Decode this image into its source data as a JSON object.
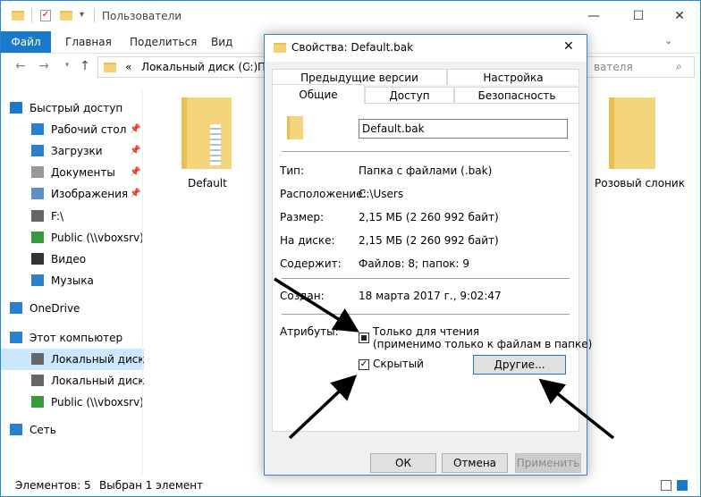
{
  "explorer": {
    "title": "Пользователи",
    "ribbon_tabs": [
      "Файл",
      "Главная",
      "Поделиться",
      "Вид"
    ],
    "address": [
      "«",
      "Локальный диск (C:)",
      "П"
    ],
    "search_placeholder": "вателя",
    "nav": [
      {
        "label": "Быстрый доступ",
        "icon": "star-icon"
      },
      {
        "label": "Рабочий стол",
        "icon": "desktop-icon",
        "pin": true
      },
      {
        "label": "Загрузки",
        "icon": "downloads-icon",
        "pin": true
      },
      {
        "label": "Документы",
        "icon": "documents-icon",
        "pin": true
      },
      {
        "label": "Изображения",
        "icon": "pictures-icon",
        "pin": true
      },
      {
        "label": "F:\\",
        "icon": "drive-icon"
      },
      {
        "label": "Public (\\\\vboxsrv) (I",
        "icon": "network-drive-icon"
      },
      {
        "label": "Видео",
        "icon": "video-icon"
      },
      {
        "label": "Музыка",
        "icon": "music-icon"
      },
      {
        "label": "OneDrive",
        "icon": "cloud-icon"
      },
      {
        "label": "Этот компьютер",
        "icon": "computer-icon"
      },
      {
        "label": "Локальный диск (С",
        "icon": "drive-icon"
      },
      {
        "label": "Локальный диск (D",
        "icon": "drive-icon"
      },
      {
        "label": "Public (\\\\vboxsrv) (I",
        "icon": "network-drive-icon"
      },
      {
        "label": "Сеть",
        "icon": "network-icon"
      }
    ],
    "folders": [
      "Default",
      "Розовый слоник"
    ],
    "status": {
      "count": "Элементов: 5",
      "selected": "Выбран 1 элемент"
    }
  },
  "dialog": {
    "title": "Свойства: Default.bak",
    "tabs_back": [
      "Предыдущие версии",
      "Настройка"
    ],
    "tabs_front": [
      "Общие",
      "Доступ",
      "Безопасность"
    ],
    "name": "Default.bak",
    "rows1": [
      {
        "label": "Тип:",
        "value": "Папка с файлами (.bak)"
      },
      {
        "label": "Расположение:",
        "value": "C:\\Users"
      },
      {
        "label": "Размер:",
        "value": "2,15 МБ (2 260 992 байт)"
      },
      {
        "label": "На диске:",
        "value": "2,15 МБ (2 260 992 байт)"
      },
      {
        "label": "Содержит:",
        "value": "Файлов: 8; папок: 9"
      }
    ],
    "created_label": "Создан:",
    "created_value": "18 марта 2017 г., 9:02:47",
    "attributes_label": "Атрибуты:",
    "readonly_line1": "Только для чтения",
    "readonly_line2": "(применимо только к файлам в папке)",
    "hidden_label": "Скрытый",
    "other_button": "Другие...",
    "ok": "ОК",
    "cancel": "Отмена",
    "apply": "Применить"
  },
  "colors": {
    "accent": "#1979ca",
    "selection": "#cce8ff",
    "folder": "#f3d276"
  }
}
